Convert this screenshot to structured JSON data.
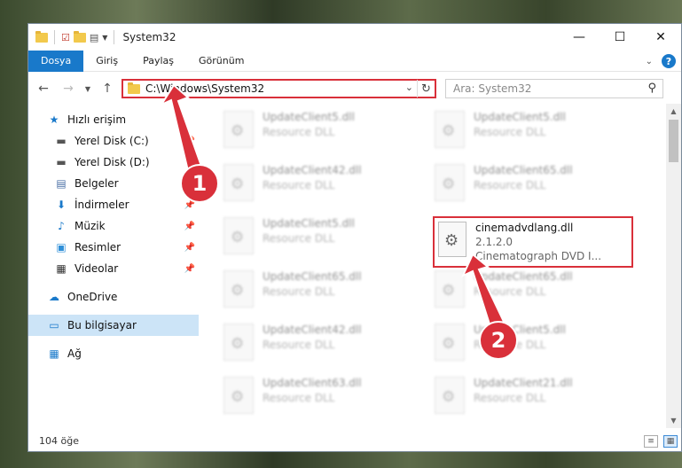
{
  "window": {
    "title": "System32",
    "controls": {
      "minimize": "—",
      "maximize": "☐",
      "close": "✕"
    }
  },
  "ribbon": {
    "tabs": [
      "Dosya",
      "Giriş",
      "Paylaş",
      "Görünüm"
    ],
    "help": "?"
  },
  "nav": {
    "address": "C:\\Windows\\System32",
    "search_placeholder": "Ara: System32"
  },
  "sidebar": {
    "items": [
      {
        "label": "Hızlı erişim",
        "icon": "star-icon"
      },
      {
        "label": "Yerel Disk (C:)",
        "icon": "drive-icon"
      },
      {
        "label": "Yerel Disk (D:)",
        "icon": "drive-icon"
      },
      {
        "label": "Belgeler",
        "icon": "document-icon"
      },
      {
        "label": "İndirmeler",
        "icon": "download-icon"
      },
      {
        "label": "Müzik",
        "icon": "music-icon"
      },
      {
        "label": "Resimler",
        "icon": "pictures-icon"
      },
      {
        "label": "Videolar",
        "icon": "video-icon"
      },
      {
        "label": "OneDrive",
        "icon": "cloud-icon"
      },
      {
        "label": "Bu bilgisayar",
        "icon": "computer-icon"
      },
      {
        "label": "Ağ",
        "icon": "network-icon"
      }
    ]
  },
  "files": [
    {
      "name": "UpdateClient5.dll",
      "type": "Resource DLL"
    },
    {
      "name": "UpdateClient5.dll",
      "type": "Resource DLL"
    },
    {
      "name": "UpdateClient42.dll",
      "type": "Resource DLL"
    },
    {
      "name": "UpdateClient65.dll",
      "type": "Resource DLL"
    },
    {
      "name": "UpdateClient5.dll",
      "type": "Resource DLL"
    },
    {
      "name": "UpdateClient65.dll",
      "type": "Resource DLL"
    },
    {
      "name": "UpdateClient65.dll",
      "type": "Resource DLL"
    },
    {
      "name": "UpdateClient42.dll",
      "type": "Resource DLL"
    },
    {
      "name": "UpdateClient5.dll",
      "type": "Resource DLL"
    },
    {
      "name": "UpdateClient63.dll",
      "type": "Resource DLL"
    },
    {
      "name": "UpdateClient21.dll",
      "type": "Resource DLL"
    }
  ],
  "highlighted_file": {
    "name": "cinemadvdlang.dll",
    "version": "2.1.2.0",
    "description": "Cinematograph DVD I..."
  },
  "status": {
    "count": "104 öğe"
  },
  "callouts": {
    "one": "1",
    "two": "2"
  },
  "colors": {
    "accent": "#1979ca",
    "highlight": "#d9303a",
    "selected": "#cce4f7"
  }
}
